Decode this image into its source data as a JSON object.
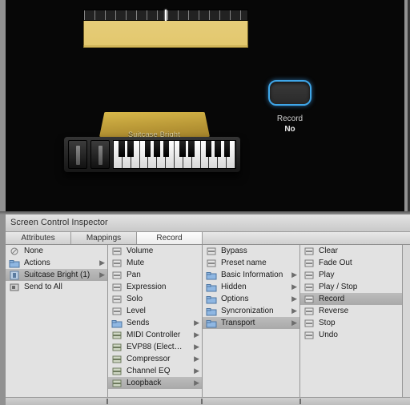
{
  "canvas": {
    "instrument_label": "Suitcase Bright",
    "record_widget": {
      "caption": "Record",
      "value": "No"
    }
  },
  "inspector": {
    "title": "Screen Control Inspector",
    "tabs": [
      "Attributes",
      "Mappings",
      "Record"
    ],
    "active_tab": 2,
    "columns": [
      {
        "items": [
          {
            "icon": "none-icon",
            "label": "None",
            "children": false
          },
          {
            "icon": "folder-icon",
            "label": "Actions",
            "children": true
          },
          {
            "icon": "channel-icon",
            "label": "Suitcase Bright (1)",
            "children": true,
            "selected": true
          },
          {
            "icon": "action-icon",
            "label": "Send to All",
            "children": false
          }
        ]
      },
      {
        "items": [
          {
            "icon": "param-icon",
            "label": "Volume",
            "children": false
          },
          {
            "icon": "param-icon",
            "label": "Mute",
            "children": false
          },
          {
            "icon": "param-icon",
            "label": "Pan",
            "children": false
          },
          {
            "icon": "param-icon",
            "label": "Expression",
            "children": false
          },
          {
            "icon": "param-icon",
            "label": "Solo",
            "children": false
          },
          {
            "icon": "param-icon",
            "label": "Level",
            "children": false
          },
          {
            "icon": "folder-icon",
            "label": "Sends",
            "children": true
          },
          {
            "icon": "plugin-icon",
            "label": "MIDI Controller",
            "children": true
          },
          {
            "icon": "plugin-icon",
            "label": "EVP88  (Elect…",
            "children": true
          },
          {
            "icon": "plugin-icon",
            "label": "Compressor",
            "children": true
          },
          {
            "icon": "plugin-icon",
            "label": "Channel EQ",
            "children": true
          },
          {
            "icon": "plugin-icon",
            "label": "Loopback",
            "children": true,
            "selected": true
          }
        ]
      },
      {
        "items": [
          {
            "icon": "param-icon",
            "label": "Bypass",
            "children": false
          },
          {
            "icon": "param-icon",
            "label": "Preset name",
            "children": false
          },
          {
            "icon": "folder-icon",
            "label": "Basic Information",
            "children": true
          },
          {
            "icon": "folder-icon",
            "label": "Hidden",
            "children": true
          },
          {
            "icon": "folder-icon",
            "label": "Options",
            "children": true
          },
          {
            "icon": "folder-icon",
            "label": "Syncronization",
            "children": true
          },
          {
            "icon": "folder-icon",
            "label": "Transport",
            "children": true,
            "selected": true
          }
        ]
      },
      {
        "items": [
          {
            "icon": "param-icon",
            "label": "Clear",
            "children": false
          },
          {
            "icon": "param-icon",
            "label": "Fade Out",
            "children": false
          },
          {
            "icon": "param-icon",
            "label": "Play",
            "children": false
          },
          {
            "icon": "param-icon",
            "label": "Play / Stop",
            "children": false
          },
          {
            "icon": "param-icon",
            "label": "Record",
            "children": false,
            "selected": true
          },
          {
            "icon": "param-icon",
            "label": "Reverse",
            "children": false
          },
          {
            "icon": "param-icon",
            "label": "Stop",
            "children": false
          },
          {
            "icon": "param-icon",
            "label": "Undo",
            "children": false
          }
        ]
      }
    ]
  },
  "icons": {
    "none-icon": "◯",
    "folder-icon": "folder",
    "channel-icon": "channel",
    "action-icon": "action",
    "param-icon": "param",
    "plugin-icon": "plugin"
  }
}
